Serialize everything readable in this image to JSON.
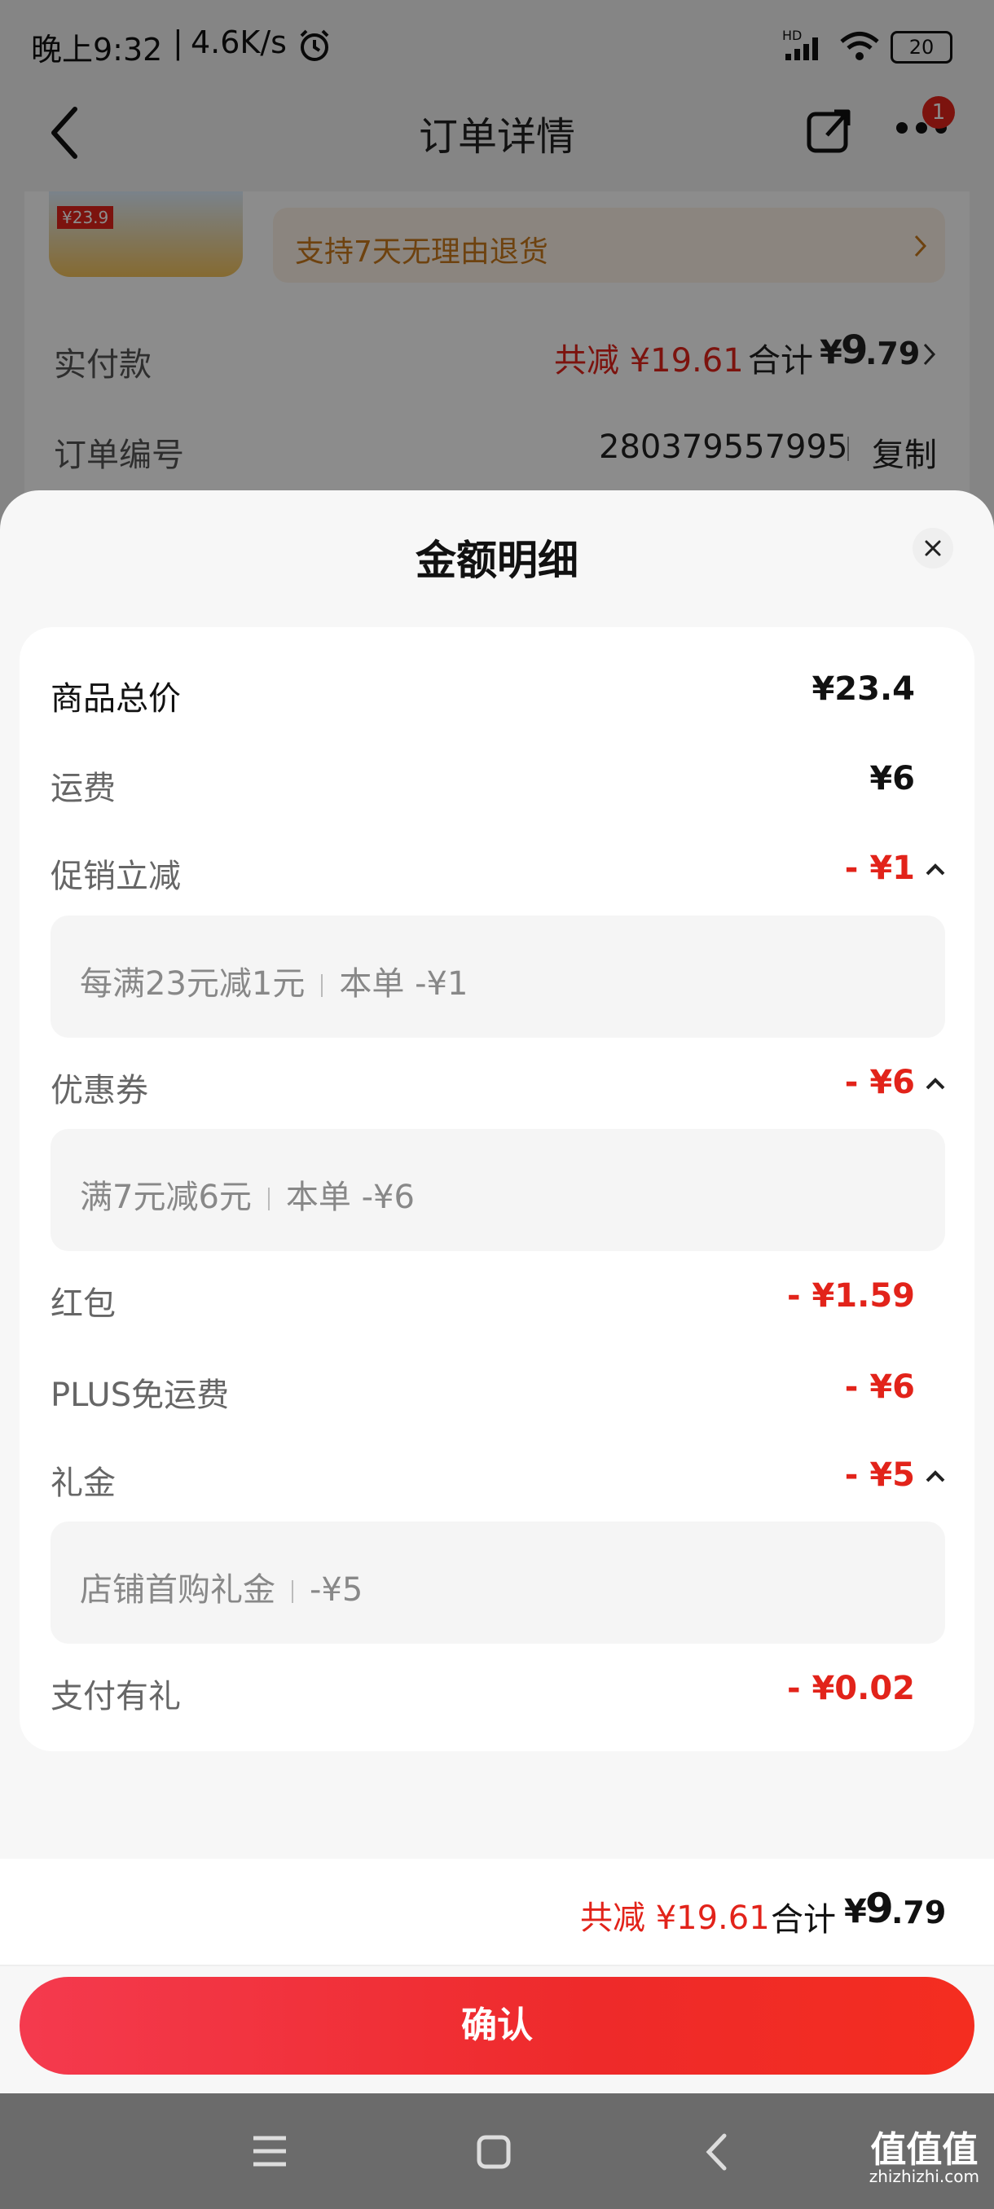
{
  "status_bar": {
    "time": "晚上9:32",
    "net_speed": "4.6K/s",
    "battery": "20",
    "signal_label": "HD"
  },
  "nav": {
    "title": "订单详情",
    "badge": "1"
  },
  "bg_page": {
    "product_thumb_price": "¥23.9",
    "return_policy": "支持7天无理由退货",
    "paid_label": "实付款",
    "paid_discount": "共减 ¥19.61",
    "paid_total_prefix": "合计",
    "paid_total_yen": "¥",
    "paid_total_int": "9",
    "paid_total_dec": ".79",
    "order_no_label": "订单编号",
    "order_no": "280379557995",
    "copy_label": "复制"
  },
  "sheet": {
    "title": "金额明细",
    "rows": [
      {
        "label": "商品总价",
        "value": "¥23.4"
      },
      {
        "label": "运费",
        "value": "¥6"
      },
      {
        "label": "促销立减",
        "value": "- ¥1",
        "detail_left": "每满23元减1元",
        "detail_right": "本单 -¥1"
      },
      {
        "label": "优惠券",
        "value": "- ¥6",
        "detail_left": "满7元减6元",
        "detail_right": "本单 -¥6"
      },
      {
        "label": "红包",
        "value": "- ¥1.59"
      },
      {
        "label": "PLUS免运费",
        "value": "- ¥6"
      },
      {
        "label": "礼金",
        "value": "- ¥5",
        "detail_left": "店铺首购礼金",
        "detail_right": "-¥5"
      },
      {
        "label": "支付有礼",
        "value": "- ¥0.02"
      }
    ]
  },
  "footer": {
    "discount": "共减 ¥19.61",
    "total_prefix": "合计",
    "total_yen": "¥",
    "total_int": "9",
    "total_dec": ".79",
    "confirm_label": "确认"
  },
  "watermark": {
    "main": "值值值",
    "sub": "zhizhizhi.com"
  },
  "colors": {
    "accent_red": "#e2231a",
    "button_gradient_start": "#f43a4e",
    "button_gradient_end": "#f42d20",
    "return_policy_text": "#c8791c"
  }
}
